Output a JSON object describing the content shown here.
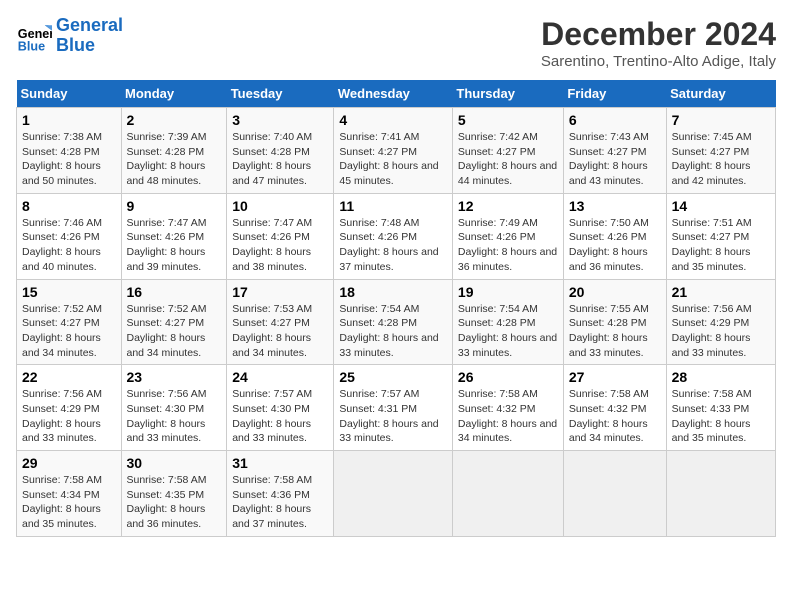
{
  "header": {
    "logo_line1": "General",
    "logo_line2": "Blue",
    "title": "December 2024",
    "subtitle": "Sarentino, Trentino-Alto Adige, Italy"
  },
  "days_of_week": [
    "Sunday",
    "Monday",
    "Tuesday",
    "Wednesday",
    "Thursday",
    "Friday",
    "Saturday"
  ],
  "weeks": [
    [
      {
        "day": 1,
        "sunrise": "7:38 AM",
        "sunset": "4:28 PM",
        "daylight": "8 hours and 50 minutes."
      },
      {
        "day": 2,
        "sunrise": "7:39 AM",
        "sunset": "4:28 PM",
        "daylight": "8 hours and 48 minutes."
      },
      {
        "day": 3,
        "sunrise": "7:40 AM",
        "sunset": "4:28 PM",
        "daylight": "8 hours and 47 minutes."
      },
      {
        "day": 4,
        "sunrise": "7:41 AM",
        "sunset": "4:27 PM",
        "daylight": "8 hours and 45 minutes."
      },
      {
        "day": 5,
        "sunrise": "7:42 AM",
        "sunset": "4:27 PM",
        "daylight": "8 hours and 44 minutes."
      },
      {
        "day": 6,
        "sunrise": "7:43 AM",
        "sunset": "4:27 PM",
        "daylight": "8 hours and 43 minutes."
      },
      {
        "day": 7,
        "sunrise": "7:45 AM",
        "sunset": "4:27 PM",
        "daylight": "8 hours and 42 minutes."
      }
    ],
    [
      {
        "day": 8,
        "sunrise": "7:46 AM",
        "sunset": "4:26 PM",
        "daylight": "8 hours and 40 minutes."
      },
      {
        "day": 9,
        "sunrise": "7:47 AM",
        "sunset": "4:26 PM",
        "daylight": "8 hours and 39 minutes."
      },
      {
        "day": 10,
        "sunrise": "7:47 AM",
        "sunset": "4:26 PM",
        "daylight": "8 hours and 38 minutes."
      },
      {
        "day": 11,
        "sunrise": "7:48 AM",
        "sunset": "4:26 PM",
        "daylight": "8 hours and 37 minutes."
      },
      {
        "day": 12,
        "sunrise": "7:49 AM",
        "sunset": "4:26 PM",
        "daylight": "8 hours and 36 minutes."
      },
      {
        "day": 13,
        "sunrise": "7:50 AM",
        "sunset": "4:26 PM",
        "daylight": "8 hours and 36 minutes."
      },
      {
        "day": 14,
        "sunrise": "7:51 AM",
        "sunset": "4:27 PM",
        "daylight": "8 hours and 35 minutes."
      }
    ],
    [
      {
        "day": 15,
        "sunrise": "7:52 AM",
        "sunset": "4:27 PM",
        "daylight": "8 hours and 34 minutes."
      },
      {
        "day": 16,
        "sunrise": "7:52 AM",
        "sunset": "4:27 PM",
        "daylight": "8 hours and 34 minutes."
      },
      {
        "day": 17,
        "sunrise": "7:53 AM",
        "sunset": "4:27 PM",
        "daylight": "8 hours and 34 minutes."
      },
      {
        "day": 18,
        "sunrise": "7:54 AM",
        "sunset": "4:28 PM",
        "daylight": "8 hours and 33 minutes."
      },
      {
        "day": 19,
        "sunrise": "7:54 AM",
        "sunset": "4:28 PM",
        "daylight": "8 hours and 33 minutes."
      },
      {
        "day": 20,
        "sunrise": "7:55 AM",
        "sunset": "4:28 PM",
        "daylight": "8 hours and 33 minutes."
      },
      {
        "day": 21,
        "sunrise": "7:56 AM",
        "sunset": "4:29 PM",
        "daylight": "8 hours and 33 minutes."
      }
    ],
    [
      {
        "day": 22,
        "sunrise": "7:56 AM",
        "sunset": "4:29 PM",
        "daylight": "8 hours and 33 minutes."
      },
      {
        "day": 23,
        "sunrise": "7:56 AM",
        "sunset": "4:30 PM",
        "daylight": "8 hours and 33 minutes."
      },
      {
        "day": 24,
        "sunrise": "7:57 AM",
        "sunset": "4:30 PM",
        "daylight": "8 hours and 33 minutes."
      },
      {
        "day": 25,
        "sunrise": "7:57 AM",
        "sunset": "4:31 PM",
        "daylight": "8 hours and 33 minutes."
      },
      {
        "day": 26,
        "sunrise": "7:58 AM",
        "sunset": "4:32 PM",
        "daylight": "8 hours and 34 minutes."
      },
      {
        "day": 27,
        "sunrise": "7:58 AM",
        "sunset": "4:32 PM",
        "daylight": "8 hours and 34 minutes."
      },
      {
        "day": 28,
        "sunrise": "7:58 AM",
        "sunset": "4:33 PM",
        "daylight": "8 hours and 35 minutes."
      }
    ],
    [
      {
        "day": 29,
        "sunrise": "7:58 AM",
        "sunset": "4:34 PM",
        "daylight": "8 hours and 35 minutes."
      },
      {
        "day": 30,
        "sunrise": "7:58 AM",
        "sunset": "4:35 PM",
        "daylight": "8 hours and 36 minutes."
      },
      {
        "day": 31,
        "sunrise": "7:58 AM",
        "sunset": "4:36 PM",
        "daylight": "8 hours and 37 minutes."
      },
      null,
      null,
      null,
      null
    ]
  ]
}
